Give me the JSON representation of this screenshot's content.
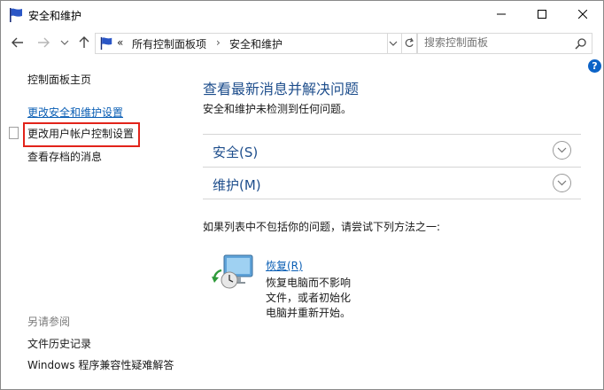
{
  "window": {
    "title": "安全和维护"
  },
  "nav": {
    "breadcrumb_overflow": "«",
    "crumbs": [
      "所有控制面板项",
      "安全和维护"
    ],
    "search_placeholder": "搜索控制面板"
  },
  "help": {
    "label": "?"
  },
  "sidebar": {
    "home": "控制面板主页",
    "change_security": "更改安全和维护设置",
    "change_uac": "更改用户帐户控制设置",
    "archived": "查看存档的消息",
    "see_also_heading": "另请参阅",
    "file_history": "文件历史记录",
    "compat": "Windows 程序兼容性疑难解答"
  },
  "main": {
    "title": "查看最新消息并解决问题",
    "status": "安全和维护未检测到任何问题。",
    "sections": [
      {
        "label": "安全(S)"
      },
      {
        "label": "维护(M)"
      }
    ],
    "hint": "如果列表中不包括你的问题，请尝试下列方法之一:",
    "recovery": {
      "link": "恢复(R)",
      "desc_lines": [
        "恢复电脑而不影响",
        "文件，或者初始化",
        "电脑并重新开始。"
      ]
    }
  },
  "colors": {
    "link": "#0b5fb5",
    "heading": "#1e4e8c",
    "highlight_box": "#e2231a",
    "help_badge": "#0c63c7"
  }
}
